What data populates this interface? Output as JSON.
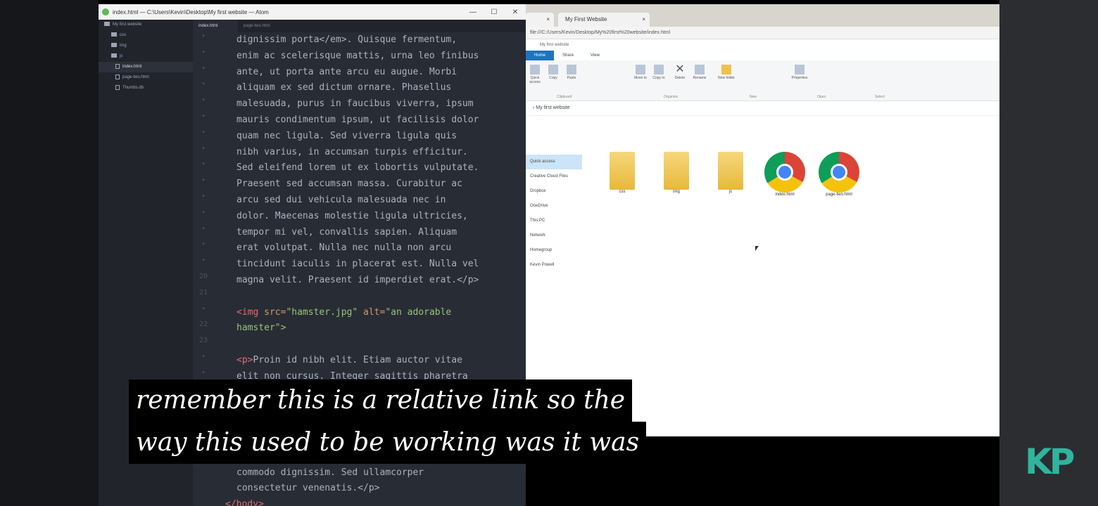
{
  "atom": {
    "title": "index.html — C:\\Users\\Kevin\\Desktop\\My first website — Atom",
    "window_controls": {
      "minimize": "—",
      "maximize": "☐",
      "close": "✕"
    },
    "tree_root": "My first website",
    "tree_items": [
      "css",
      "img",
      "js",
      "index.html",
      "page-two.html",
      "Thumbs.db"
    ],
    "tabs": [
      "index.html",
      "page-two.html"
    ],
    "gutter": [
      "•",
      "•",
      "•",
      "•",
      "•",
      "•",
      "•",
      "•",
      "•",
      "•",
      "•",
      "•",
      "•",
      "•",
      "•",
      "20",
      "21",
      "•",
      "22",
      "23",
      "•",
      "•",
      "•",
      "•",
      "•"
    ],
    "code_lines": [
      "dignissim porta</em>. Quisque fermentum,",
      "enim ac scelerisque mattis, urna leo finibus",
      "ante, ut porta ante arcu eu augue. Morbi",
      "aliquam ex sed dictum ornare. Phasellus",
      "malesuada, purus in faucibus viverra, ipsum",
      "mauris condimentum ipsum, ut facilisis dolor",
      "quam nec ligula. Sed viverra ligula quis",
      "nibh varius, in accumsan turpis efficitur.",
      "Sed eleifend lorem ut ex lobortis vulputate.",
      "Praesent sed accumsan massa. Curabitur ac",
      "arcu sed dui vehicula malesuada nec in",
      "dolor. Maecenas molestie ligula ultricies,",
      "tempor mi vel, convallis sapien. Aliquam",
      "erat volutpat. Nulla nec nulla non arcu",
      "tincidunt iaculis in placerat est. Nulla vel",
      "magna velit. Praesent id imperdiet erat.</p>"
    ],
    "img_line": {
      "open": "<img",
      "attr1": " src=",
      "val1": "\"hamster.jpg\"",
      "attr2": " alt=",
      "val2": "\"an adorable"
    },
    "img_line2": "hamster\">",
    "p_line": {
      "open": "<p>",
      "text": "Proin id nibh elit. Etiam auctor vitae"
    },
    "p_line2": "elit non cursus. Integer sagittis pharetra",
    "bottom_lines": [
      "commodo dignissim. Sed ullamcorper",
      "consectetur venenatis.</p>",
      "</body>"
    ]
  },
  "browser": {
    "tab_title": "My First Website",
    "tab_close": "×",
    "url": "file:///C:/Users/Kevin/Desktop/My%20first%20website/index.html",
    "explorer_title": "My first website",
    "ribbon_tabs": [
      "Home",
      "Share",
      "View"
    ],
    "ribbon_buttons": [
      "Quick access",
      "Copy",
      "Paste",
      "Move to",
      "Copy to",
      "Delete",
      "Rename",
      "New folder",
      "Properties"
    ],
    "ribbon_groups": [
      "Clipboard",
      "Organize",
      "New",
      "Open",
      "Select"
    ],
    "address": "› My first website",
    "nav_items": [
      "Quick access",
      "Creative Cloud Files",
      "Dropbox",
      "OneDrive",
      "This PC",
      "Network",
      "Homegroup",
      "Kevin Powell"
    ],
    "files": [
      "css",
      "img",
      "js",
      "index.html",
      "page-two.html"
    ]
  },
  "captions": {
    "line1": "remember this is a relative link so the",
    "line2": "way this used to be working was it was"
  },
  "logo": "KP",
  "colors": {
    "accent": "#2fb59d",
    "editor_bg": "#282c34",
    "tag": "#e06c75",
    "string": "#98c379"
  }
}
